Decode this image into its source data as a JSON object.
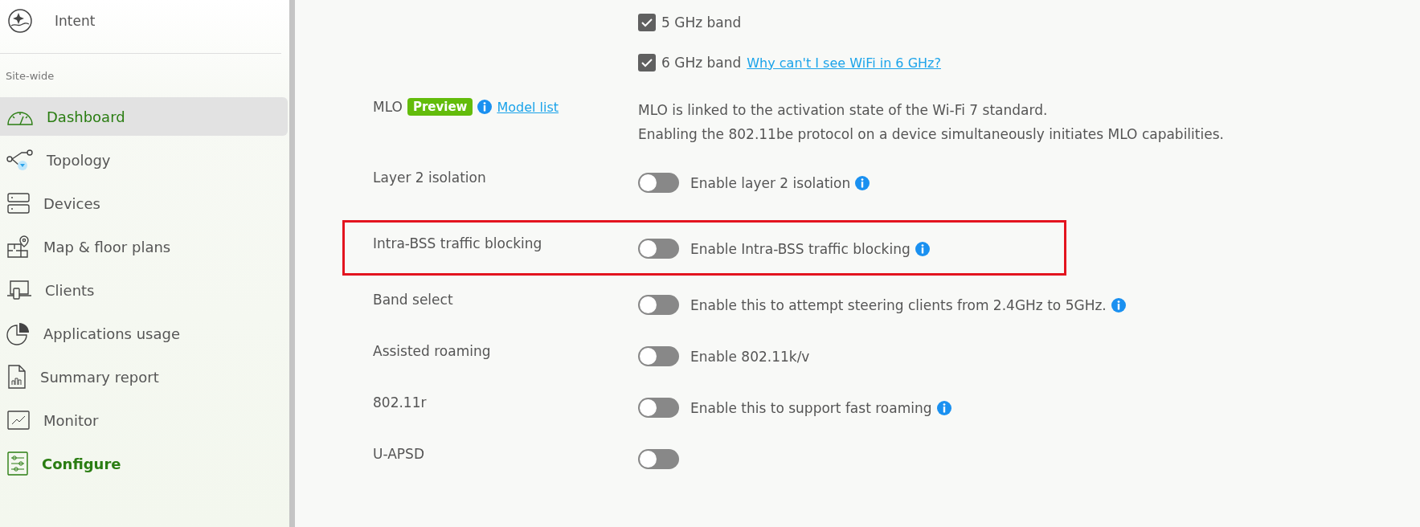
{
  "sidebar": {
    "top_item": {
      "label": "Intent"
    },
    "section_title": "Site-wide",
    "items": [
      {
        "label": "Dashboard",
        "selected": true,
        "current": false
      },
      {
        "label": "Topology",
        "selected": false,
        "current": false
      },
      {
        "label": "Devices",
        "selected": false,
        "current": false
      },
      {
        "label": "Map & floor plans",
        "selected": false,
        "current": false
      },
      {
        "label": "Clients",
        "selected": false,
        "current": false
      },
      {
        "label": "Applications usage",
        "selected": false,
        "current": false
      },
      {
        "label": "Summary report",
        "selected": false,
        "current": false
      },
      {
        "label": "Monitor",
        "selected": false,
        "current": false
      },
      {
        "label": "Configure",
        "selected": false,
        "current": true
      }
    ]
  },
  "settings": [
    {
      "kind": "bands",
      "options": [
        {
          "label": "5 GHz band",
          "checked": true
        },
        {
          "label": "6 GHz band",
          "checked": true,
          "link": "Why can't I see WiFi in 6 GHz?"
        }
      ]
    },
    {
      "kind": "mlo",
      "label": "MLO",
      "badge": "Preview",
      "info": true,
      "link": "Model list",
      "description": [
        "MLO is linked to the activation state of the Wi-Fi 7 standard.",
        "Enabling the 802.11be protocol on a device simultaneously initiates MLO capabilities."
      ]
    },
    {
      "kind": "toggle",
      "label": "Layer 2 isolation",
      "on": false,
      "text": "Enable layer 2 isolation",
      "info": true,
      "highlighted": false
    },
    {
      "kind": "toggle",
      "label": "Intra-BSS traffic blocking",
      "on": false,
      "text": "Enable Intra-BSS traffic blocking",
      "info": true,
      "highlighted": true
    },
    {
      "kind": "toggle",
      "label": "Band select",
      "on": false,
      "text": "Enable this to attempt steering clients from 2.4GHz to 5GHz.",
      "info": true,
      "highlighted": false
    },
    {
      "kind": "toggle",
      "label": "Assisted roaming",
      "on": false,
      "text": "Enable 802.11k/v",
      "info": false,
      "highlighted": false
    },
    {
      "kind": "toggle",
      "label": "802.11r",
      "on": false,
      "text": "Enable this to support fast roaming",
      "info": true,
      "highlighted": false
    },
    {
      "kind": "toggle",
      "label": "U-APSD",
      "on": false,
      "highlighted": false
    }
  ]
}
